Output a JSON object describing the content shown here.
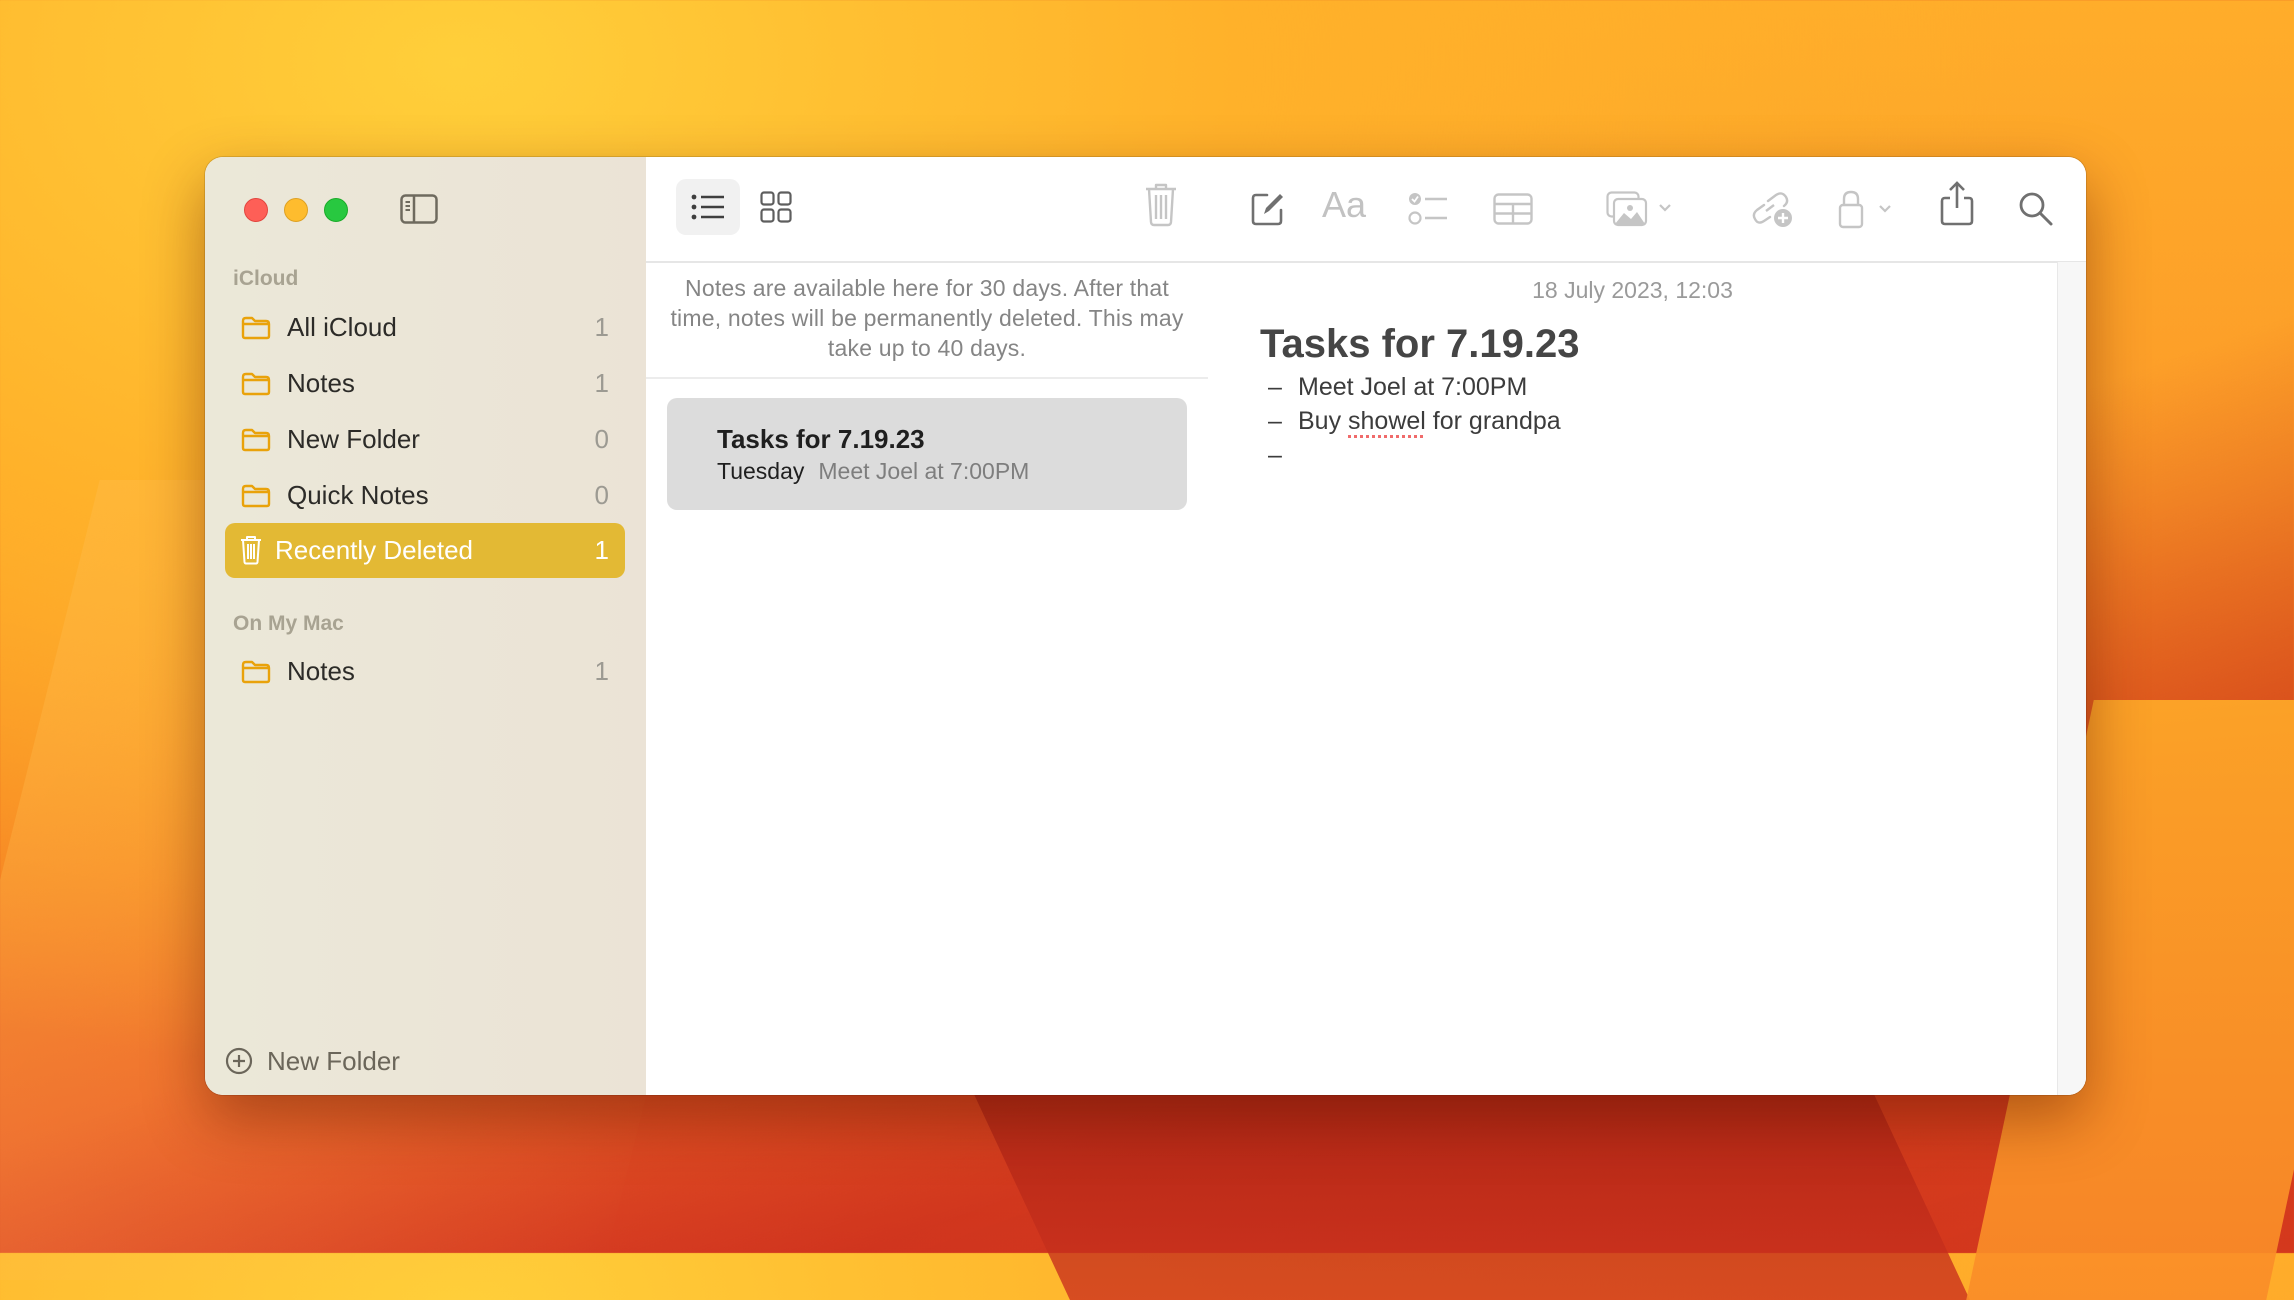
{
  "window": {
    "traffic_lights": {
      "close": "close",
      "minimize": "minimize",
      "zoom": "zoom"
    },
    "colors": {
      "accent": "#e3b934",
      "folder_icon": "#e9a20a"
    }
  },
  "sidebar": {
    "sections": [
      {
        "header": "iCloud",
        "items": [
          {
            "label": "All iCloud",
            "count": "1",
            "icon": "folder-icon",
            "selected": false
          },
          {
            "label": "Notes",
            "count": "1",
            "icon": "folder-icon",
            "selected": false
          },
          {
            "label": "New Folder",
            "count": "0",
            "icon": "folder-icon",
            "selected": false
          },
          {
            "label": "Quick Notes",
            "count": "0",
            "icon": "folder-icon",
            "selected": false
          },
          {
            "label": "Recently Deleted",
            "count": "1",
            "icon": "trash-icon",
            "selected": true
          }
        ]
      },
      {
        "header": "On My Mac",
        "items": [
          {
            "label": "Notes",
            "count": "1",
            "icon": "folder-icon",
            "selected": false
          }
        ]
      }
    ],
    "new_folder_label": "New Folder"
  },
  "list": {
    "view_modes": [
      "list-view",
      "gallery-view"
    ],
    "active_view": "list-view",
    "info_text": "Notes are available here for 30 days. After that time, notes will be permanently deleted. This may take up to 40 days.",
    "notes": [
      {
        "title": "Tasks for 7.19.23",
        "date": "Tuesday",
        "preview": "Meet Joel at 7:00PM",
        "selected": true
      }
    ]
  },
  "editor": {
    "toolbar": [
      "compose-icon",
      "format-icon",
      "checklist-icon",
      "table-icon",
      "media-icon",
      "collaborate-icon",
      "lock-icon",
      "share-icon",
      "search-icon"
    ],
    "format_label": "Aa",
    "date": "18 July 2023, 12:03",
    "title": "Tasks for 7.19.23",
    "bullet_char": "–",
    "bullets": [
      {
        "before": "Meet Joel at 7:00PM",
        "misspelled": "",
        "after": ""
      },
      {
        "before": "Buy ",
        "misspelled": "showel",
        "after": " for grandpa"
      },
      {
        "before": "",
        "misspelled": "",
        "after": ""
      }
    ]
  }
}
